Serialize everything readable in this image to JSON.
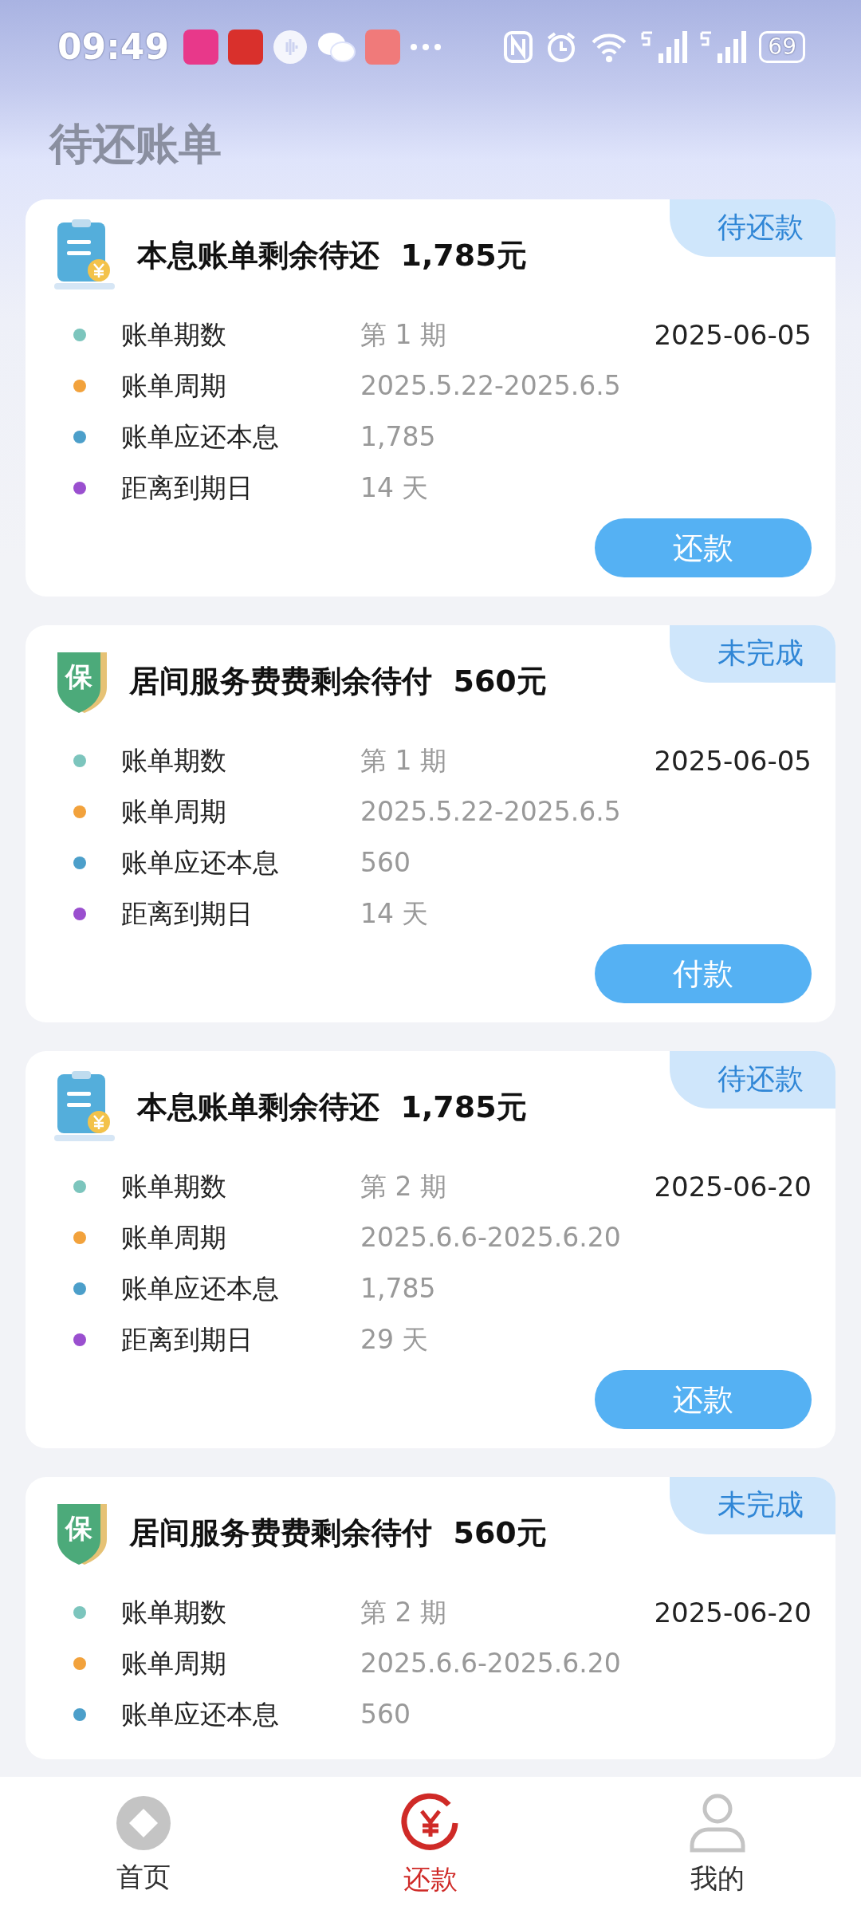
{
  "status_bar": {
    "time": "09:49",
    "battery": "69"
  },
  "page_title": "待还账单",
  "bills": [
    {
      "kind": "loan",
      "title": "本息账单剩余待还",
      "amount": "1,785元",
      "tag": "待还款",
      "date": "2025-06-05",
      "rows": [
        {
          "label": "账单期数",
          "value": "第 1 期"
        },
        {
          "label": "账单周期",
          "value": "2025.5.22-2025.6.5"
        },
        {
          "label": "账单应还本息",
          "value": "1,785"
        },
        {
          "label": "距离到期日",
          "value": "14 天"
        }
      ],
      "button": "还款"
    },
    {
      "kind": "fee",
      "icon_text": "保",
      "title": "居间服务费费剩余待付",
      "amount": "560元",
      "tag": "未完成",
      "date": "2025-06-05",
      "rows": [
        {
          "label": "账单期数",
          "value": "第 1 期"
        },
        {
          "label": "账单周期",
          "value": "2025.5.22-2025.6.5"
        },
        {
          "label": "账单应还本息",
          "value": "560"
        },
        {
          "label": "距离到期日",
          "value": "14 天"
        }
      ],
      "button": "付款"
    },
    {
      "kind": "loan",
      "title": "本息账单剩余待还",
      "amount": "1,785元",
      "tag": "待还款",
      "date": "2025-06-20",
      "rows": [
        {
          "label": "账单期数",
          "value": "第 2 期"
        },
        {
          "label": "账单周期",
          "value": "2025.6.6-2025.6.20"
        },
        {
          "label": "账单应还本息",
          "value": "1,785"
        },
        {
          "label": "距离到期日",
          "value": "29 天"
        }
      ],
      "button": "还款"
    },
    {
      "kind": "fee",
      "icon_text": "保",
      "title": "居间服务费费剩余待付",
      "amount": "560元",
      "tag": "未完成",
      "date": "2025-06-20",
      "rows": [
        {
          "label": "账单期数",
          "value": "第 2 期"
        },
        {
          "label": "账单周期",
          "value": "2025.6.6-2025.6.20"
        },
        {
          "label": "账单应还本息",
          "value": "560"
        }
      ]
    }
  ],
  "bottom_nav": [
    {
      "kind": "home",
      "label": "首页",
      "selected": false
    },
    {
      "kind": "repay",
      "label": "还款",
      "selected": true
    },
    {
      "kind": "me",
      "label": "我的",
      "selected": false
    }
  ]
}
